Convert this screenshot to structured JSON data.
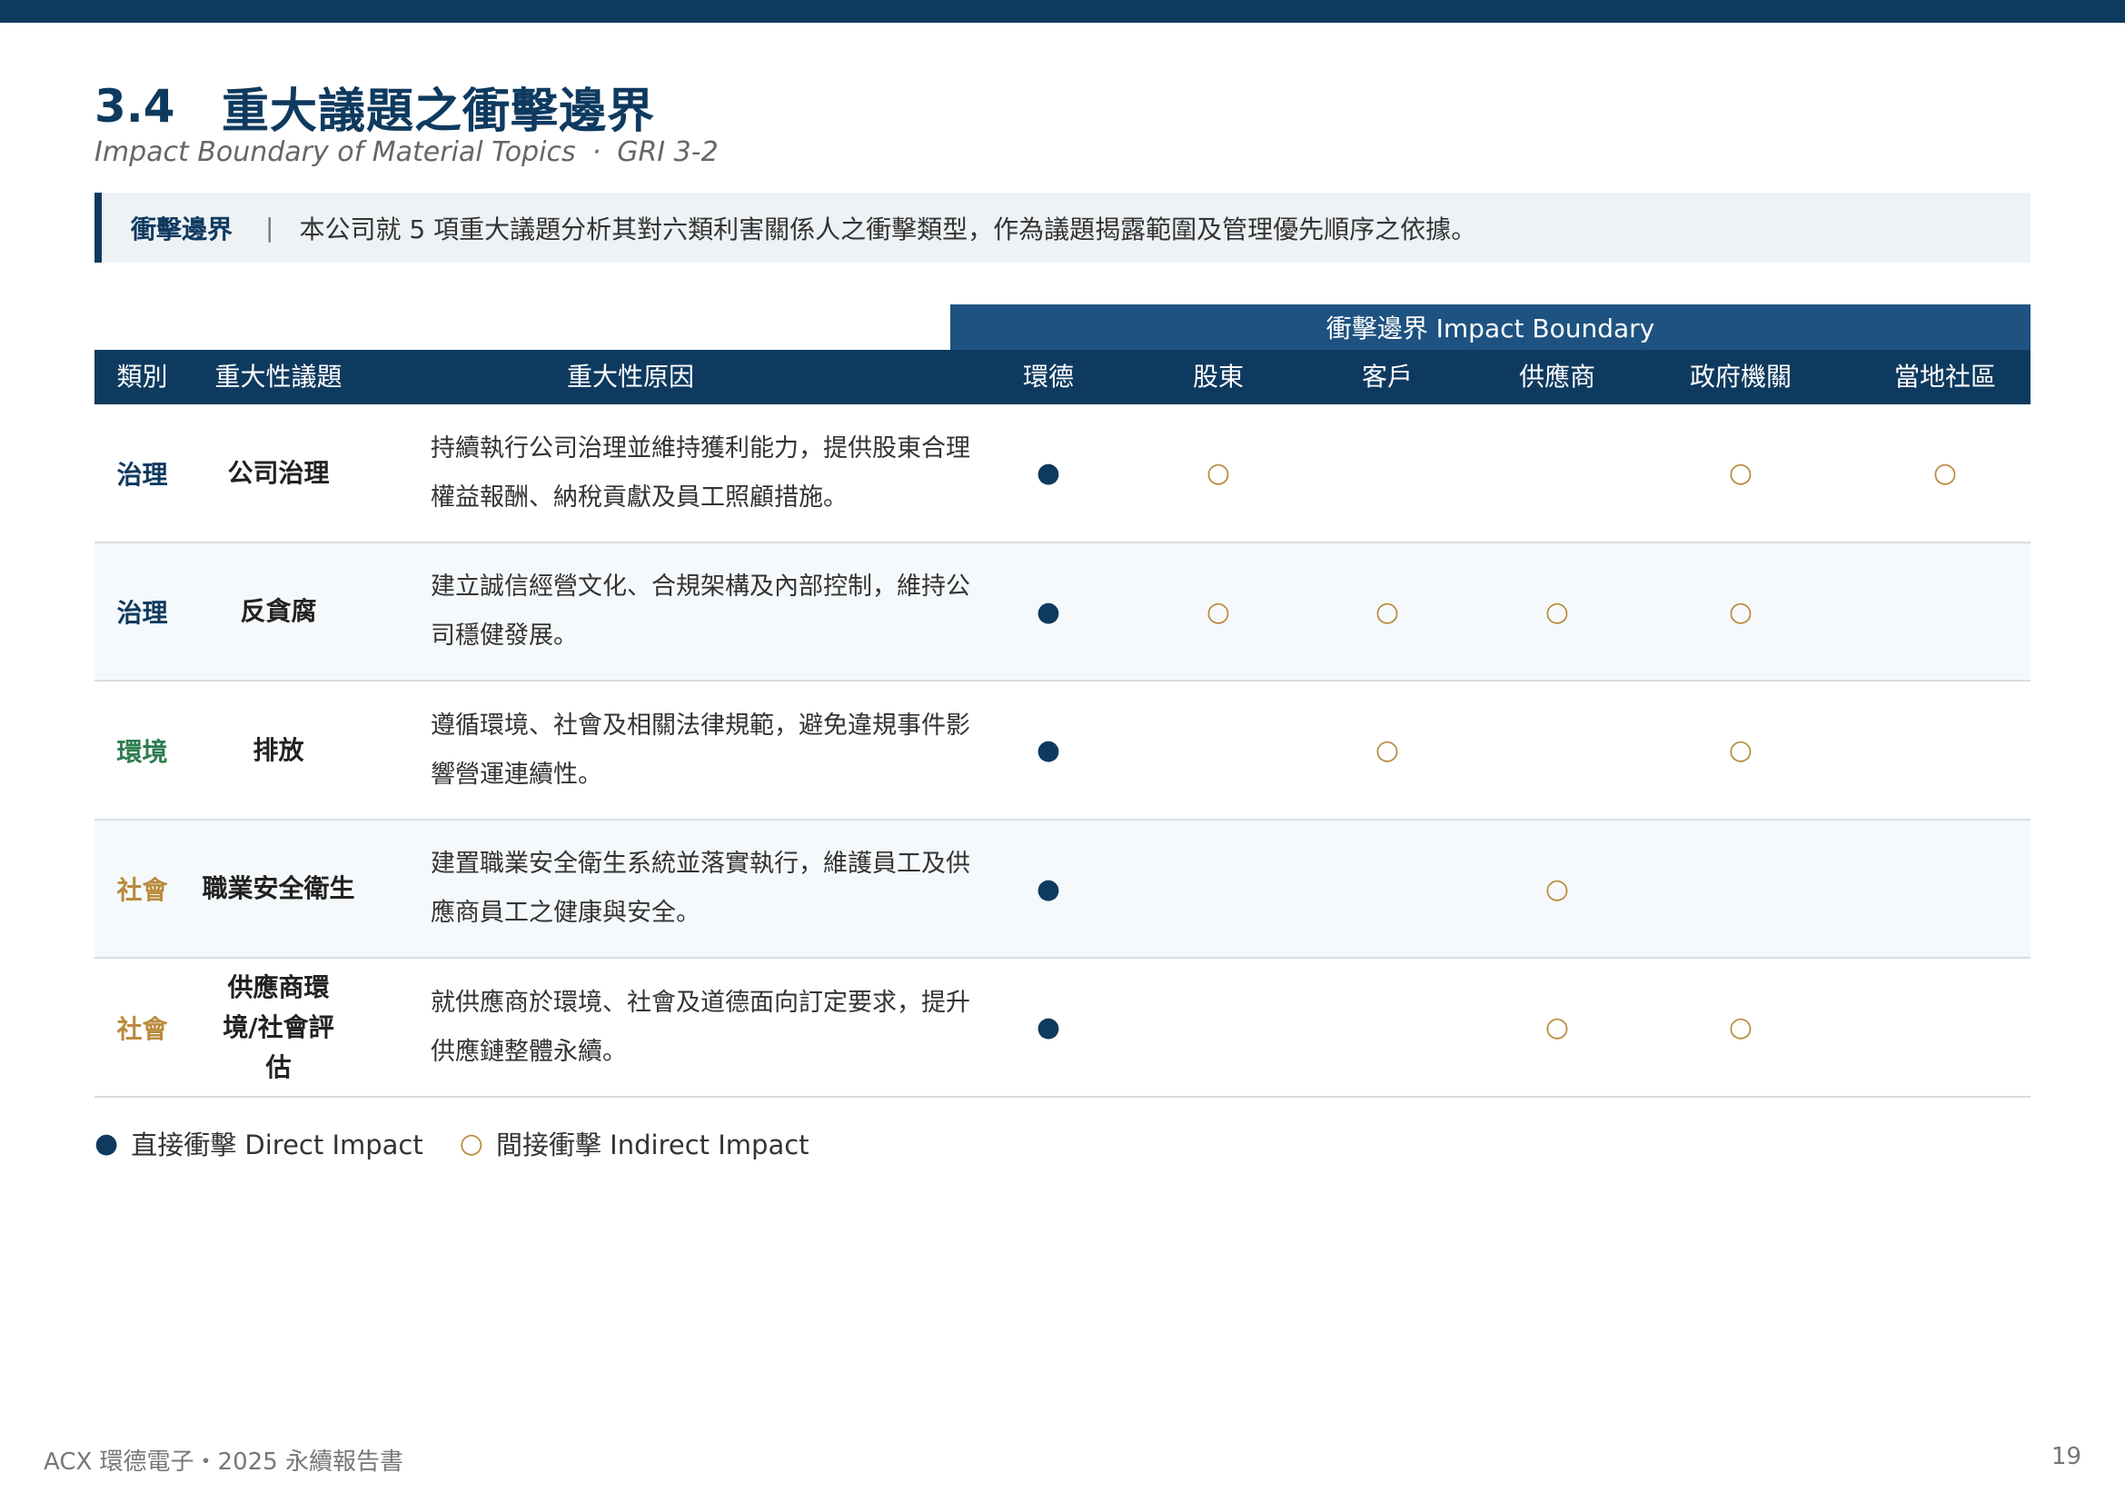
{
  "section": {
    "number": "3.4",
    "title": "重大議題之衝擊邊界",
    "subtitle": "Impact Boundary of Material Topics",
    "subtitle_sep": "·",
    "gri": "GRI 3-2"
  },
  "callout": {
    "label": "衝擊邊界",
    "separator": "|",
    "text": "本公司就 5 項重大議題分析其對六類利害關係人之衝擊類型，作為議題揭露範圍及管理優先順序之依據。"
  },
  "table": {
    "boundary_header": "衝擊邊界 Impact Boundary",
    "headers": [
      "類別",
      "重大性議題",
      "重大性原因",
      "環德",
      "股東",
      "客戶",
      "供應商",
      "政府機關",
      "當地社區"
    ],
    "rows": [
      {
        "category": "治理",
        "category_color": "#0f3a5f",
        "topic": "公司治理",
        "reason": "持續執行公司治理並維持獲利能力，提供股東合理權益報酬、納稅貢獻及員工照顧措施。",
        "marks": [
          "●",
          "○",
          "",
          "",
          "○",
          "○"
        ]
      },
      {
        "category": "治理",
        "category_color": "#0f3a5f",
        "topic": "反貪腐",
        "reason": "建立誠信經營文化、合規架構及內部控制，維持公司穩健發展。",
        "marks": [
          "●",
          "○",
          "○",
          "○",
          "○",
          ""
        ]
      },
      {
        "category": "環境",
        "category_color": "#2e7d4f",
        "topic": "排放",
        "reason": "遵循環境、社會及相關法律規範，避免違規事件影響營運連續性。",
        "marks": [
          "●",
          "",
          "○",
          "",
          "○",
          ""
        ]
      },
      {
        "category": "社會",
        "category_color": "#b98b3c",
        "topic": "職業安全衛生",
        "reason": "建置職業安全衛生系統並落實執行，維護員工及供應商員工之健康與安全。",
        "marks": [
          "●",
          "",
          "",
          "○",
          "",
          ""
        ]
      },
      {
        "category": "社會",
        "category_color": "#b98b3c",
        "topic": "供應商環境/社會評估",
        "reason": "就供應商於環境、社會及道德面向訂定要求，提升供應鏈整體永續。",
        "marks": [
          "●",
          "",
          "",
          "○",
          "○",
          ""
        ]
      }
    ]
  },
  "legend": {
    "direct_symbol": "●",
    "direct_label": "直接衝擊 Direct Impact",
    "indirect_symbol": "○",
    "indirect_label": "間接衝擊 Indirect Impact"
  },
  "footer": {
    "text": "ACX 環德電子・2025 永續報告書",
    "page": "19"
  },
  "colors": {
    "navy": "#0f3a5f",
    "boundary_blue": "#1e5280",
    "gold": "#b98b3c",
    "green": "#2e7d4f"
  }
}
